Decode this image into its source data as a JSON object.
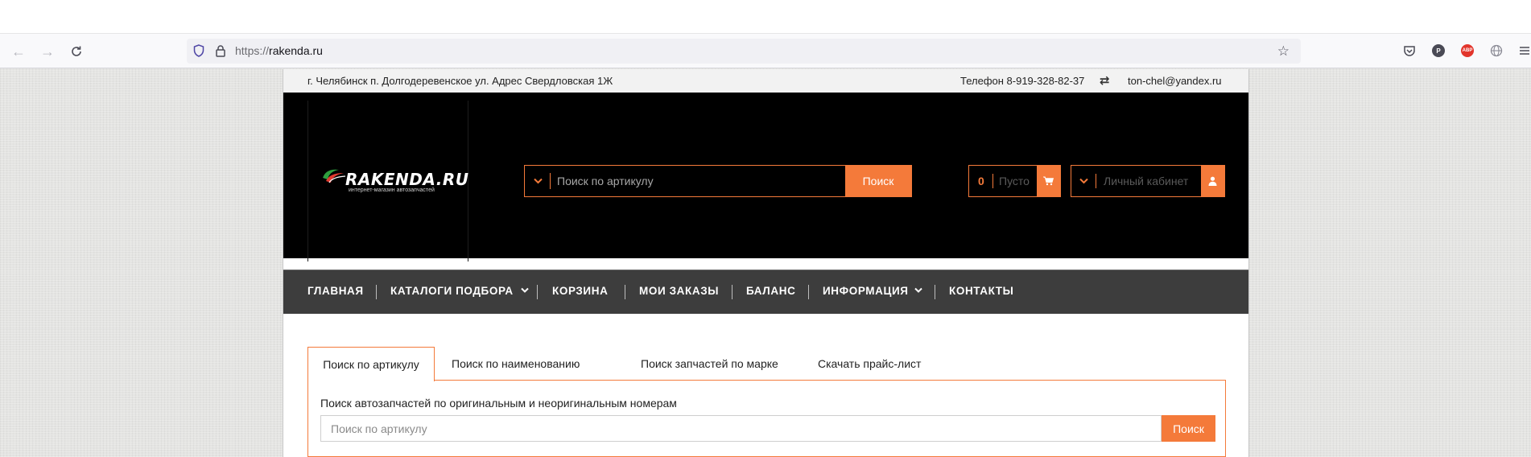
{
  "browser": {
    "url_protocol": "https://",
    "url_host": "rakenda.ru",
    "profile_initial": "P",
    "abp_label": "ABP"
  },
  "site": {
    "topbar": {
      "address": "г. Челябинск п. Долгодеревенское ул. Адрес Свердловская 1Ж",
      "phone": "Телефон 8-919-328-82-37",
      "email": "ton-chel@yandex.ru"
    },
    "logo": {
      "text": "RAKENDA.RU",
      "tagline": "интернет-магазин автозапчастей"
    },
    "header_search": {
      "placeholder": "Поиск по артикулу",
      "button": "Поиск"
    },
    "cart": {
      "count": "0",
      "label": "Пусто"
    },
    "account": {
      "label": "Личный кабинет"
    },
    "nav": {
      "items": [
        {
          "label": "ГЛАВНАЯ"
        },
        {
          "label": "КАТАЛОГИ ПОДБОРА"
        },
        {
          "label": "КОРЗИНА"
        },
        {
          "label": "МОИ ЗАКАЗЫ"
        },
        {
          "label": "БАЛАНС"
        },
        {
          "label": "ИНФОРМАЦИЯ"
        },
        {
          "label": "КОНТАКТЫ"
        }
      ]
    },
    "tabs": [
      {
        "label": "Поиск по артикулу"
      },
      {
        "label": "Поиск по наименованию"
      },
      {
        "label": "Поиск запчастей по марке"
      },
      {
        "label": "Скачать прайс-лист"
      }
    ],
    "panel": {
      "description": "Поиск автозапчастей по оригинальным и неоригинальным номерам",
      "placeholder": "Поиск по артикулу",
      "button": "Поиск"
    },
    "colors": {
      "accent": "#f47a3a",
      "header_bg": "#000000",
      "nav_bg": "#3d3d3d"
    }
  }
}
